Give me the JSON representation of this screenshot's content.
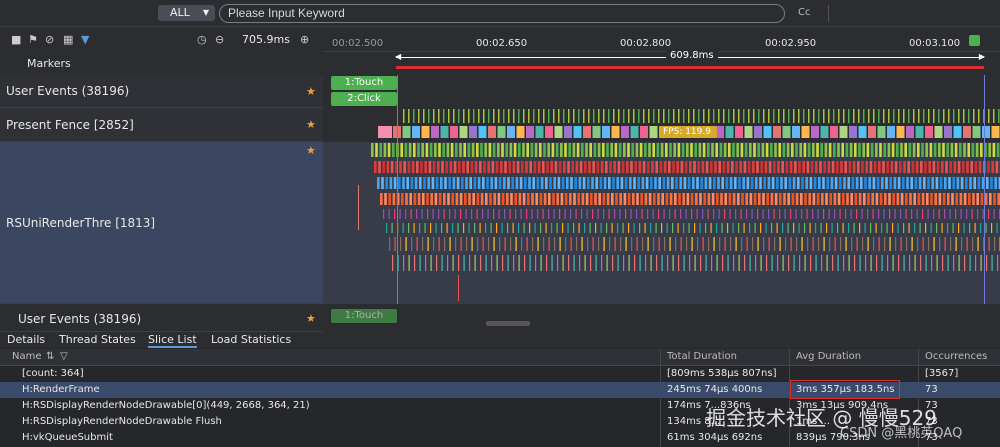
{
  "search": {
    "filter_label": "ALL",
    "placeholder": "Please Input Keyword",
    "case_label": "Cc"
  },
  "toolbar": {
    "zoom_value": "705.9ms"
  },
  "markers": {
    "label": "Markers"
  },
  "timeline": {
    "ticks": [
      "00:02.500",
      "00:02.650",
      "00:02.800",
      "00:02.950",
      "00:03.100"
    ],
    "selection_duration": "609.8ms",
    "fps_label": "FPS: 119.9"
  },
  "rows": {
    "user_events": "User Events (38196)",
    "present_fence": "Present Fence [2852]",
    "rs_render": "RSUniRenderThre [1813]",
    "user_events_pinned": "User Events (38196)"
  },
  "events": {
    "touch": "1:Touch",
    "click": "2:Click",
    "touch_pinned": "1:Touch"
  },
  "tabs": [
    "Details",
    "Thread States",
    "Slice List",
    "Load Statistics"
  ],
  "table": {
    "headers": [
      "Name",
      "Total Duration",
      "Avg Duration",
      "Occurrences"
    ],
    "rows": [
      [
        "[count: 364]",
        "[809ms 538µs 807ns]",
        "",
        "[3567]"
      ],
      [
        "H:RenderFrame",
        "245ms 74µs 400ns",
        "3ms 357µs 183.5ns",
        "73"
      ],
      [
        "H:RSDisplayRenderNodeDrawable[0](449, 2668, 364, 21)",
        "174ms 7...836ns",
        "3ms 13µs 909.4ns",
        "73"
      ],
      [
        "H:RSDisplayRenderNodeDrawable Flush",
        "134ms 8...",
        "1ms ...",
        "73"
      ],
      [
        "H:vkQueueSubmit",
        "61ms 304µs 692ns",
        "839µs 790.3ns",
        "73"
      ]
    ]
  },
  "watermark": {
    "line1": "掘金技术社区 @ 慢慢529",
    "line2": "CSDN @黑桃英QAQ"
  },
  "colors": {
    "accent": "#5b9bd5",
    "selected_row": "#3a4a6a",
    "event_green": "#4caf50",
    "range_red": "#d9302c",
    "fps_badge": "#d9a92a"
  }
}
